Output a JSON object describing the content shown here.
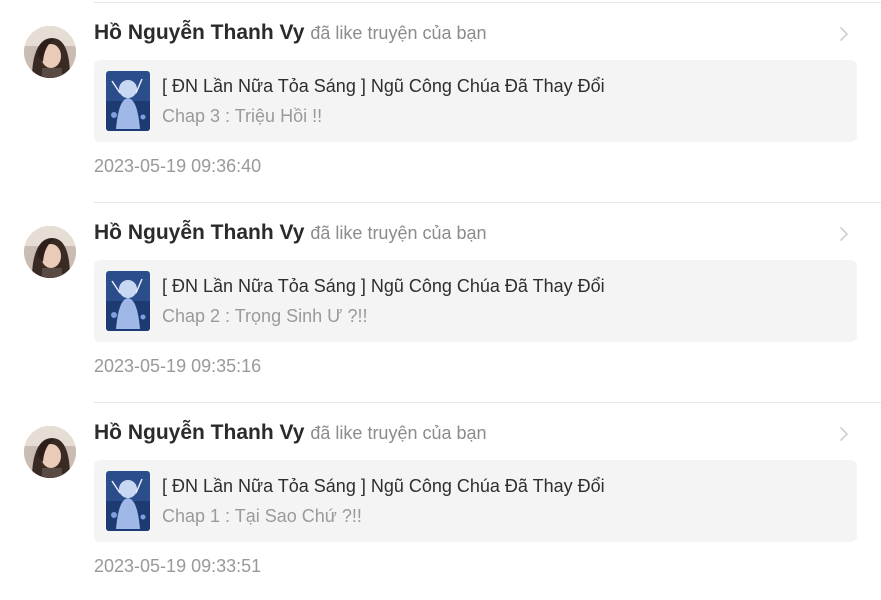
{
  "notifications": [
    {
      "user_name": "Hồ Nguyễn Thanh Vy",
      "action": "đã like truyện của bạn",
      "story_title": "[ ĐN Lần Nữa Tỏa Sáng ] Ngũ Công Chúa Đã Thay Đổi",
      "chapter_title": "Chap 3 : Triệu Hồi !!",
      "timestamp": "2023-05-19 09:36:40"
    },
    {
      "user_name": "Hồ Nguyễn Thanh Vy",
      "action": "đã like truyện của bạn",
      "story_title": "[ ĐN Lần Nữa Tỏa Sáng ] Ngũ Công Chúa Đã Thay Đổi",
      "chapter_title": "Chap 2 : Trọng Sinh Ư ?!!",
      "timestamp": "2023-05-19 09:35:16"
    },
    {
      "user_name": "Hồ Nguyễn Thanh Vy",
      "action": "đã like truyện của bạn",
      "story_title": "[ ĐN Lần Nữa Tỏa Sáng ] Ngũ Công Chúa Đã Thay Đổi",
      "chapter_title": "Chap 1 : Tại Sao Chứ ?!!",
      "timestamp": "2023-05-19 09:33:51"
    }
  ],
  "icons": {
    "chevron": "chevron-right-icon",
    "avatar": "user-avatar",
    "cover": "story-cover"
  },
  "colors": {
    "card_bg": "#f4f4f4",
    "name": "#2b2b2b",
    "muted": "#999999"
  }
}
